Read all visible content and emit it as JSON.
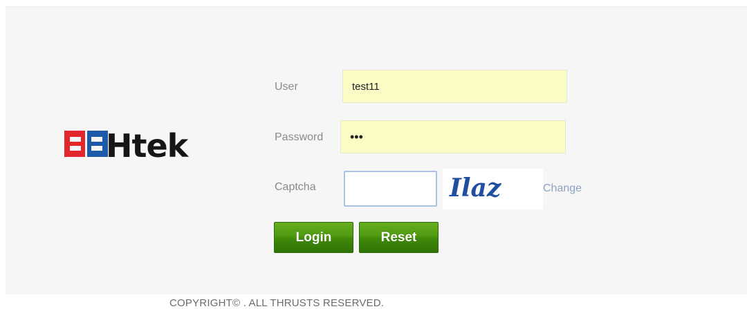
{
  "brand": {
    "logo_text": "Htek",
    "colors": {
      "red": "#e3262c",
      "blue": "#1e5aa8",
      "black": "#161616"
    }
  },
  "login_form": {
    "user_label": "User",
    "user_value": "test11",
    "password_label": "Password",
    "password_value": "•••",
    "captcha_label": "Captcha",
    "captcha_value": "",
    "captcha_text": "Ilaz",
    "change_label": "Change",
    "login_label": "Login",
    "reset_label": "Reset"
  },
  "footer": {
    "copyright": "COPYRIGHT© . ALL THRUSTS RESERVED."
  },
  "colors": {
    "input_bg": "#fbfbc6",
    "button_green": "#4f9a10",
    "link": "#8ea3c0"
  }
}
